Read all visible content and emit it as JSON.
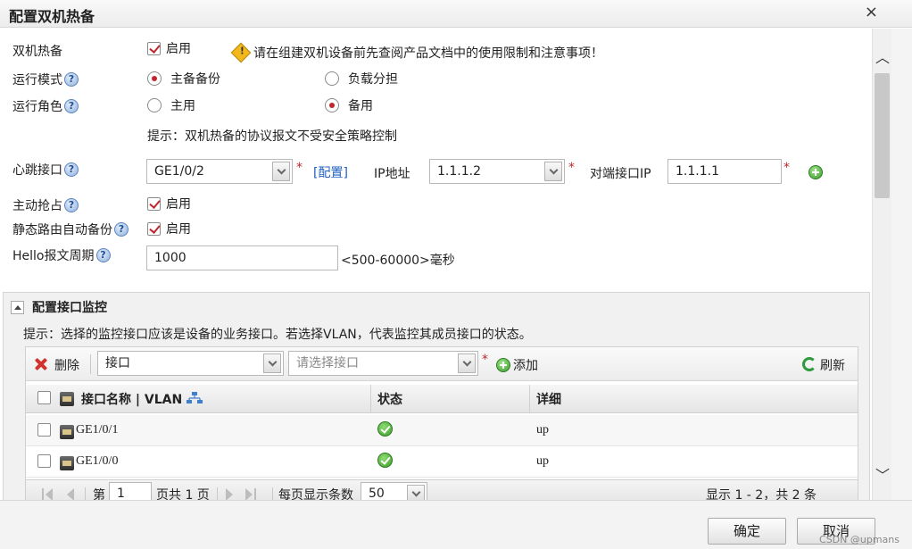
{
  "dialog": {
    "title": "配置双机热备",
    "close": "×"
  },
  "form": {
    "ha": {
      "label": "双机热备",
      "enable": "启用",
      "warning": "请在组建双机设备前先查阅产品文档中的使用限制和注意事项！"
    },
    "mode": {
      "label": "运行模式",
      "opt1": "主备备份",
      "opt2": "负载分担"
    },
    "role": {
      "label": "运行角色",
      "opt1": "主用",
      "opt2": "备用"
    },
    "hint": "提示：双机热备的协议报文不受安全策略控制",
    "heartbeat": {
      "label": "心跳接口",
      "value": "GE1/0/2",
      "config_link": "[配置]",
      "ip_label": "IP地址",
      "ip_value": "1.1.1.2",
      "peer_label": "对端接口IP",
      "peer_value": "1.1.1.1"
    },
    "preempt": {
      "label": "主动抢占",
      "enable": "启用"
    },
    "static_route": {
      "label": "静态路由自动备份",
      "enable": "启用"
    },
    "hello": {
      "label": "Hello报文周期",
      "value": "1000",
      "range": "<500-60000>毫秒"
    }
  },
  "monitor": {
    "title": "配置接口监控",
    "hint": "提示：选择的监控接口应该是设备的业务接口。若选择VLAN，代表监控其成员接口的状态。",
    "toolbar": {
      "delete": "删除",
      "type_value": "接口",
      "iface_placeholder": "请选择接口",
      "add": "添加",
      "refresh": "刷新"
    },
    "columns": {
      "name": "接口名称 | VLAN",
      "status": "状态",
      "detail": "详细"
    },
    "rows": [
      {
        "name": "GE1/0/1",
        "detail": "up"
      },
      {
        "name": "GE1/0/0",
        "detail": "up"
      }
    ],
    "pager": {
      "page_prefix": "第",
      "page_value": "1",
      "page_suffix": "页共 1 页",
      "per_page_label": "每页显示条数",
      "per_page_value": "50",
      "summary": "显示 1 - 2，共 2 条"
    }
  },
  "footer": {
    "ok": "确定",
    "cancel": "取消",
    "watermark": "CSDN @upmans"
  }
}
